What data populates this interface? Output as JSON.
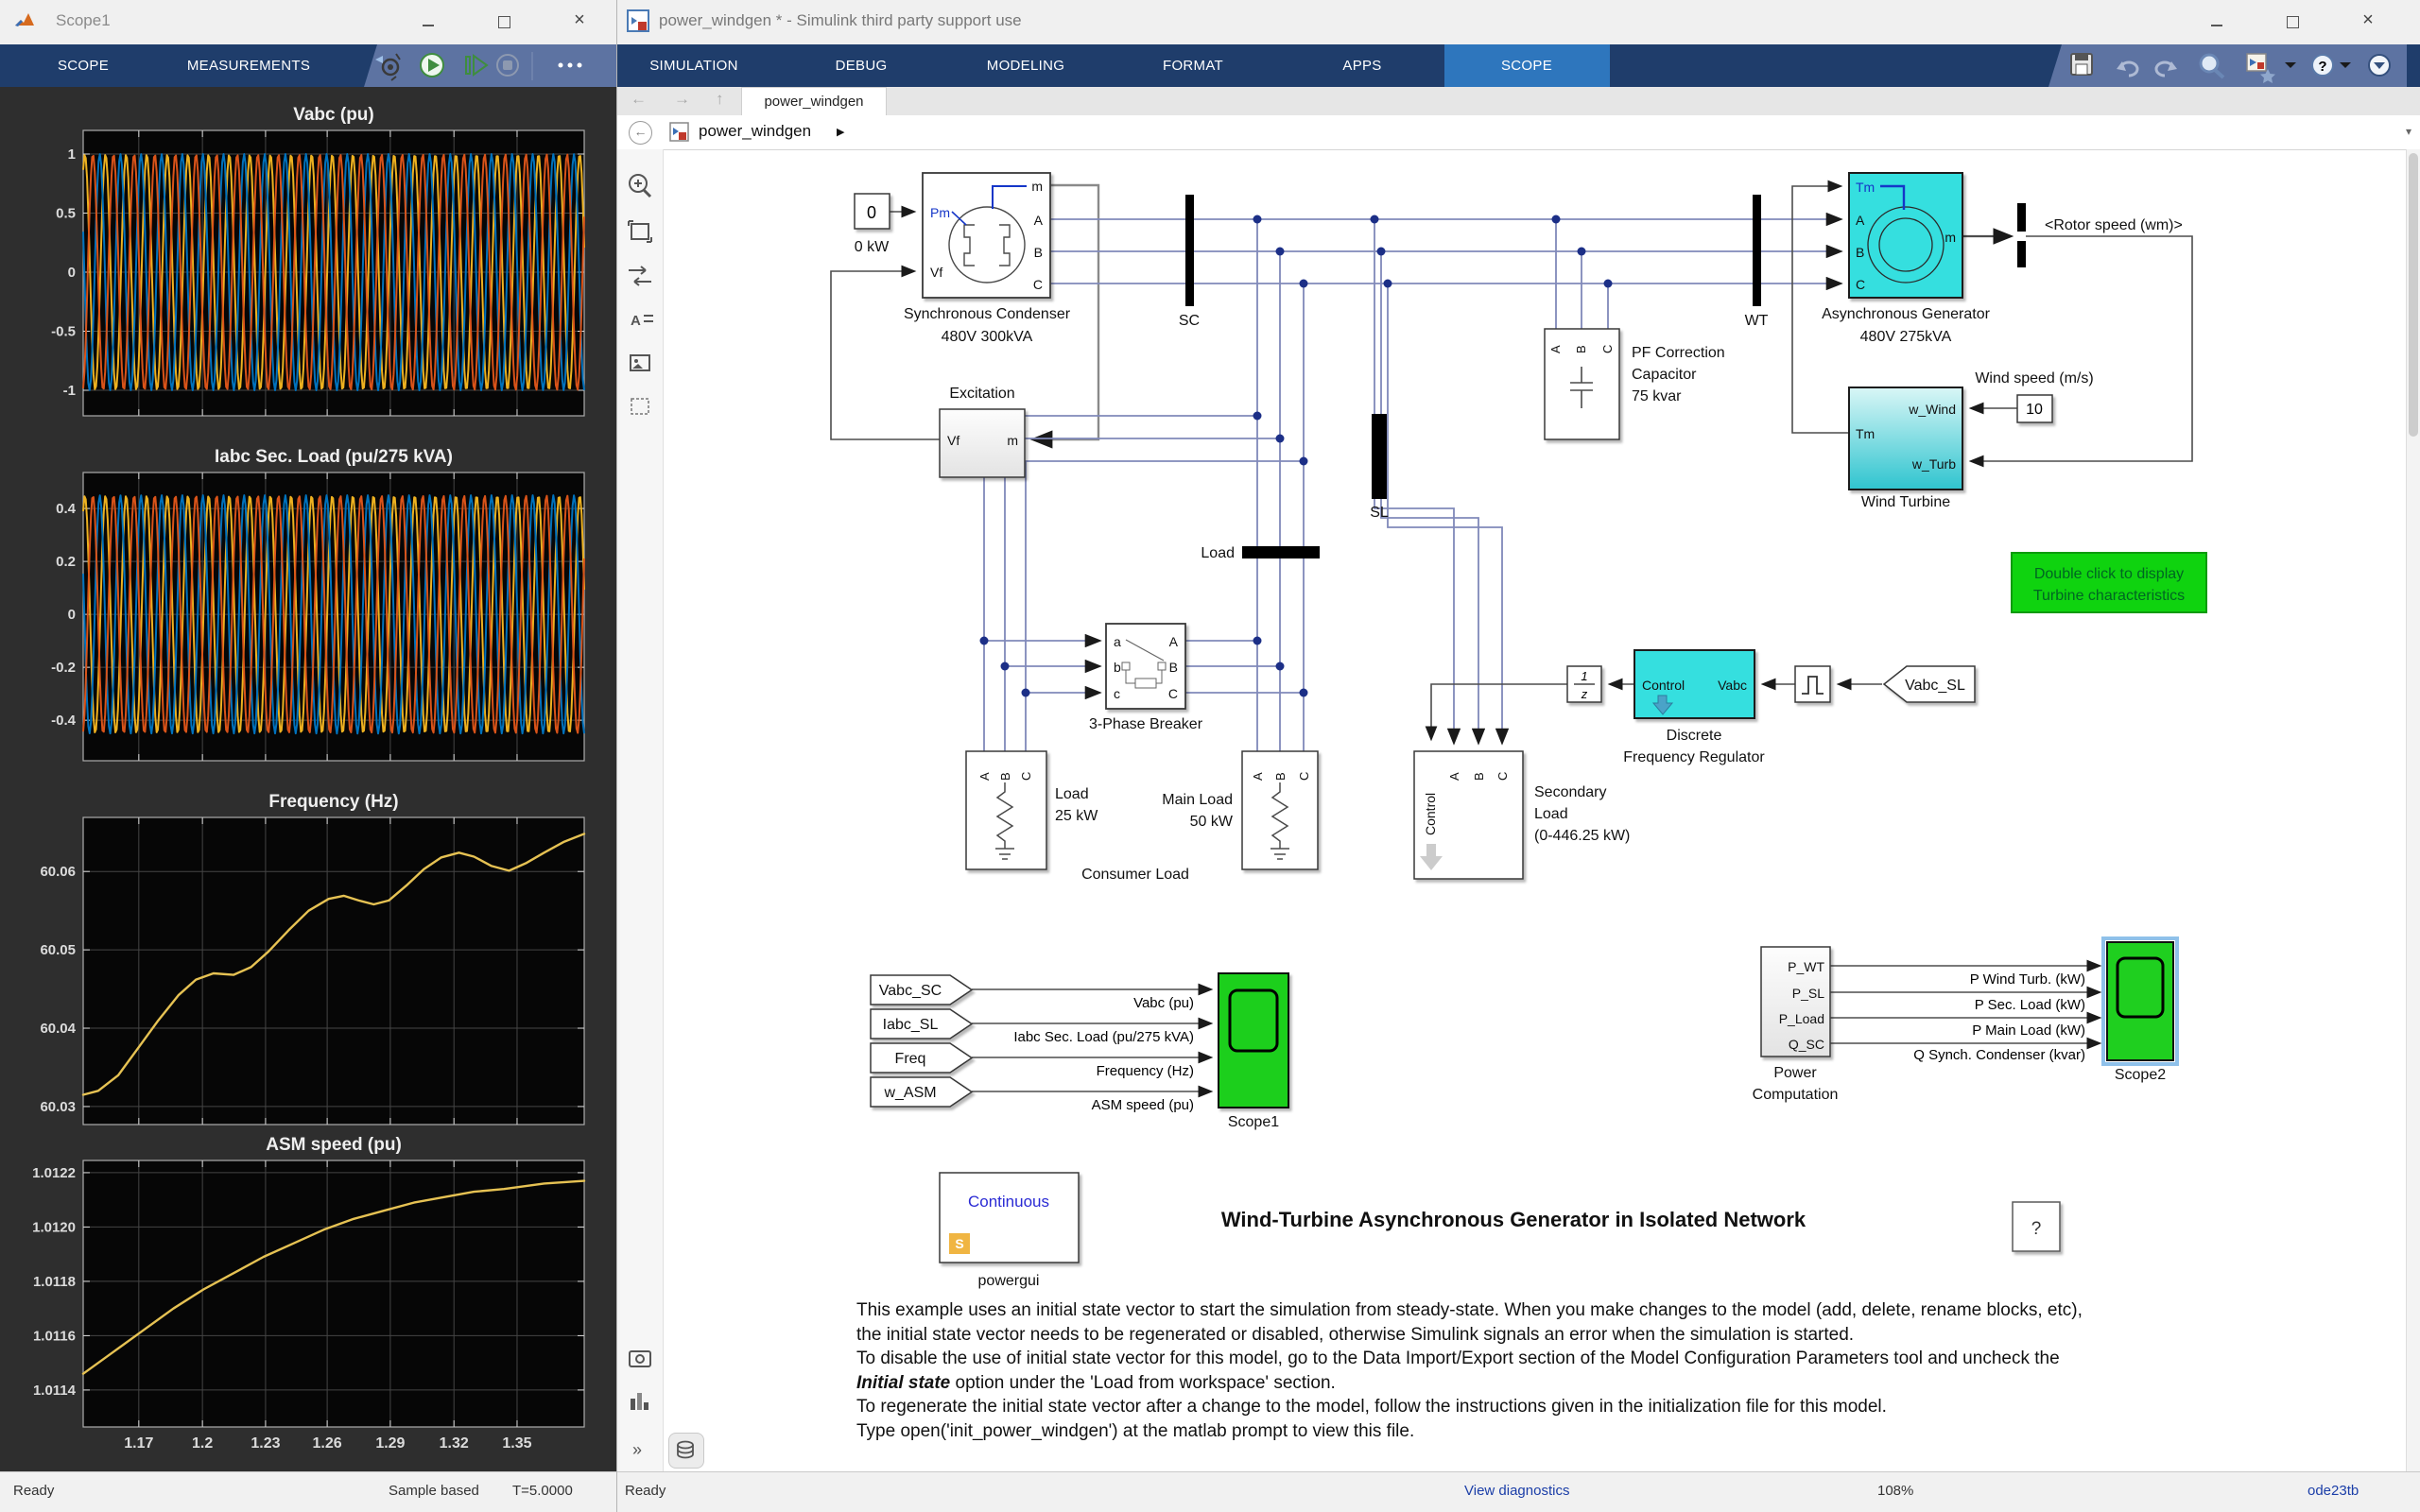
{
  "scope_window": {
    "title": "Scope1",
    "tabs": [
      "SCOPE",
      "MEASUREMENTS"
    ],
    "toolbar_icons": [
      "settings",
      "run",
      "step-forward",
      "stop",
      "more"
    ],
    "status": {
      "ready": "Ready",
      "mode": "Sample based",
      "time": "T=5.0000"
    }
  },
  "main_window": {
    "title": "power_windgen * - Simulink third party support use",
    "ribbon_tabs": [
      "SIMULATION",
      "DEBUG",
      "MODELING",
      "FORMAT",
      "APPS",
      "SCOPE"
    ],
    "active_tab": "SCOPE",
    "doc_tab": "power_windgen",
    "breadcrumb": "power_windgen",
    "status": {
      "ready": "Ready",
      "diagnostics": "View diagnostics",
      "zoom": "108%",
      "solver": "ode23tb"
    }
  },
  "chart_data": [
    {
      "type": "line",
      "title": "Vabc (pu)",
      "waveform": "three_phase_sine",
      "cycles": 24.3,
      "amplitude": 1.0,
      "phases_deg": [
        60,
        160,
        280
      ],
      "colors": [
        "#EDB120",
        "#0072BD",
        "#D95319"
      ],
      "ylim": [
        -1.216,
        1.2
      ],
      "yticks": [
        {
          "v": 1,
          "label": "1"
        },
        {
          "v": 0.5,
          "label": "0.5"
        },
        {
          "v": 0,
          "label": "0"
        },
        {
          "v": -0.5,
          "label": "-0.5"
        },
        {
          "v": -1,
          "label": "-1"
        }
      ],
      "xticks_norm": [
        0.111,
        0.238,
        0.364,
        0.487,
        0.613,
        0.74,
        0.866
      ]
    },
    {
      "type": "line",
      "title": "Iabc Sec. Load (pu/275 kVA)",
      "waveform": "three_phase_sine",
      "cycles": 24.3,
      "amplitude": 0.45,
      "phases_deg": [
        60,
        160,
        280
      ],
      "colors": [
        "#EDB120",
        "#0072BD",
        "#D95319"
      ],
      "ylim": [
        -0.553,
        0.536
      ],
      "yticks": [
        {
          "v": 0.4,
          "label": "0.4"
        },
        {
          "v": 0.2,
          "label": "0.2"
        },
        {
          "v": 0,
          "label": "0"
        },
        {
          "v": -0.2,
          "label": "-0.2"
        },
        {
          "v": -0.4,
          "label": "-0.4"
        }
      ],
      "xticks_norm": [
        0.111,
        0.238,
        0.364,
        0.487,
        0.613,
        0.74,
        0.866
      ]
    },
    {
      "type": "line",
      "title": "Frequency (Hz)",
      "color": "#E6C253",
      "ylim": [
        60.0277,
        60.0669
      ],
      "yticks": [
        {
          "v": 60.06,
          "label": "60.06"
        },
        {
          "v": 60.05,
          "label": "60.05"
        },
        {
          "v": 60.04,
          "label": "60.04"
        },
        {
          "v": 60.03,
          "label": "60.03"
        }
      ],
      "xticks_norm": [
        0.111,
        0.238,
        0.364,
        0.487,
        0.613,
        0.74,
        0.866
      ],
      "points": [
        [
          0,
          60.0315
        ],
        [
          0.03,
          60.032
        ],
        [
          0.07,
          60.034
        ],
        [
          0.11,
          60.0375
        ],
        [
          0.15,
          60.041
        ],
        [
          0.19,
          60.0442
        ],
        [
          0.225,
          60.0462
        ],
        [
          0.26,
          60.047
        ],
        [
          0.3,
          60.0468
        ],
        [
          0.335,
          60.0478
        ],
        [
          0.37,
          60.0498
        ],
        [
          0.41,
          60.0525
        ],
        [
          0.45,
          60.055
        ],
        [
          0.49,
          60.0565
        ],
        [
          0.52,
          60.0569
        ],
        [
          0.55,
          60.0563
        ],
        [
          0.58,
          60.0558
        ],
        [
          0.61,
          60.0563
        ],
        [
          0.645,
          60.0582
        ],
        [
          0.68,
          60.0603
        ],
        [
          0.715,
          60.0618
        ],
        [
          0.75,
          60.0624
        ],
        [
          0.78,
          60.0619
        ],
        [
          0.815,
          60.0607
        ],
        [
          0.85,
          60.0601
        ],
        [
          0.885,
          60.0611
        ],
        [
          0.92,
          60.0624
        ],
        [
          0.96,
          60.0638
        ],
        [
          1,
          60.0648
        ]
      ]
    },
    {
      "type": "line",
      "title": "ASM speed (pu)",
      "color": "#E6C253",
      "ylim": [
        1.011264,
        1.012245
      ],
      "xlim": [
        1.1435,
        1.382
      ],
      "yticks": [
        {
          "v": 1.0122,
          "label": "1.0122"
        },
        {
          "v": 1.012,
          "label": "1.0120"
        },
        {
          "v": 1.0118,
          "label": "1.0118"
        },
        {
          "v": 1.0116,
          "label": "1.0116"
        },
        {
          "v": 1.0114,
          "label": "1.0114"
        }
      ],
      "xticks_norm": [
        0.111,
        0.238,
        0.364,
        0.487,
        0.613,
        0.74,
        0.866
      ],
      "xtick_labels": [
        "1.17",
        "1.2",
        "1.23",
        "1.26",
        "1.29",
        "1.32",
        "1.35"
      ],
      "points": [
        [
          0,
          1.01146
        ],
        [
          0.06,
          1.01154
        ],
        [
          0.12,
          1.01162
        ],
        [
          0.18,
          1.0117
        ],
        [
          0.24,
          1.01177
        ],
        [
          0.3,
          1.01183
        ],
        [
          0.36,
          1.01189
        ],
        [
          0.42,
          1.01194
        ],
        [
          0.48,
          1.01199
        ],
        [
          0.54,
          1.01203
        ],
        [
          0.6,
          1.01206
        ],
        [
          0.66,
          1.01209
        ],
        [
          0.72,
          1.01211
        ],
        [
          0.78,
          1.01213
        ],
        [
          0.84,
          1.01214
        ],
        [
          0.92,
          1.01216
        ],
        [
          1,
          1.01217
        ]
      ]
    }
  ],
  "model": {
    "const_zero": {
      "value": "0",
      "label": "0 kW"
    },
    "sync_condenser": {
      "line1": "Synchronous Condenser",
      "line2": "480V 300kVA",
      "ports": {
        "pm": "Pm",
        "vf": "Vf",
        "m": "m",
        "a": "A",
        "b": "B",
        "c": "C"
      }
    },
    "excitation": {
      "label": "Excitation",
      "port_vf": "Vf",
      "port_m": "m"
    },
    "sc_meas": {
      "label": "SC"
    },
    "wt_meas": {
      "label": "WT"
    },
    "sl_meas": {
      "label": "SL"
    },
    "load_bus": {
      "label": "Load"
    },
    "pf_capacitor": {
      "line1": "PF Correction",
      "line2": "Capacitor",
      "line3": "75 kvar",
      "ports": [
        "A",
        "B",
        "C"
      ]
    },
    "async_generator": {
      "line1": "Asynchronous Generator",
      "line2": "480V 275kVA",
      "ports": {
        "tm": "Tm",
        "a": "A",
        "b": "B",
        "c": "C",
        "m": "m"
      }
    },
    "rotor_speed_label": "<Rotor speed (wm)>",
    "wind_speed": {
      "label": "Wind speed (m/s)",
      "value": "10"
    },
    "wind_turbine": {
      "label": "Wind Turbine",
      "ports": {
        "w_wind": "w_Wind",
        "tm": "Tm",
        "w_turb": "w_Turb"
      }
    },
    "breaker": {
      "label": "3-Phase Breaker",
      "ports_in": [
        "a",
        "b",
        "c"
      ],
      "ports_out": [
        "A",
        "B",
        "C"
      ]
    },
    "load25": {
      "line1": "Load",
      "line2": "25 kW",
      "ports": [
        "A",
        "B",
        "C"
      ]
    },
    "main_load": {
      "line1": "Main Load",
      "line2": "50 kW",
      "ports": [
        "A",
        "B",
        "C"
      ]
    },
    "consumer_load": "Consumer Load",
    "secondary_load": {
      "line1": "Secondary",
      "line2": "Load",
      "line3": "(0-446.25 kW)",
      "port_control": "Control",
      "ports": [
        "A",
        "B",
        "C"
      ]
    },
    "unit_delay": {
      "num": "1",
      "den": "z"
    },
    "freq_regulator": {
      "line1": "Discrete",
      "line2": "Frequency Regulator",
      "port_control": "Control",
      "port_vabc": "Vabc"
    },
    "vabc_sl_tag": "Vabc_SL",
    "goto_tags": [
      "Vabc_SC",
      "Iabc_SL",
      "Freq",
      "w_ASM"
    ],
    "scope1": {
      "label": "Scope1",
      "signals": [
        "Vabc (pu)",
        "Iabc Sec. Load (pu/275 kVA)",
        "Frequency (Hz)",
        "ASM speed (pu)"
      ]
    },
    "power_computation": {
      "line1": "Power",
      "line2": "Computation",
      "ports": [
        "P_WT",
        "P_SL",
        "P_Load",
        "Q_SC"
      ],
      "signals": [
        "P Wind Turb.  (kW)",
        "P Sec. Load  (kW)",
        "P Main Load (kW)",
        "Q Synch.  Condenser (kvar)"
      ]
    },
    "scope2": {
      "label": "Scope2"
    },
    "powergui": {
      "mode": "Continuous",
      "label": "powergui"
    },
    "help_block": "?",
    "turbine_note": {
      "line1": "Double click to display",
      "line2": "Turbine characteristics"
    },
    "title": "Wind-Turbine Asynchronous Generator in Isolated Network",
    "description": [
      "This example uses an initial state vector to start the simulation from steady-state. When you make changes to the model (add, delete, rename blocks, etc),",
      "the initial state vector needs to be regenerated or disabled, otherwise Simulink signals an error when the simulation is started.",
      "To disable the use of initial state vector for this model, go to the Data Import/Export section of the Model Configuration Parameters tool and uncheck the"
    ],
    "description_bold": "Initial state",
    "description_after": " option under the 'Load from workspace' section.",
    "description2": [
      "To regenerate the initial state vector after a change to the model, follow the instructions given in the initialization file for this model.",
      "Type open('init_power_windgen') at the matlab prompt to view this file."
    ]
  }
}
